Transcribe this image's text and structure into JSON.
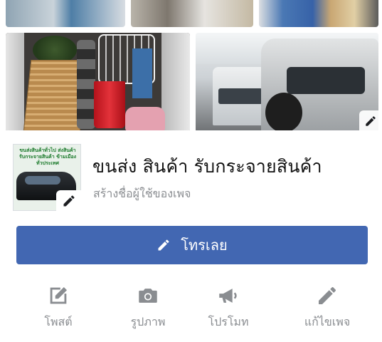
{
  "cover": {
    "profile_thumbnail_text": "ขนส่งสินค้าทั่วไป ส่งสินค้า รับกระจายสินค้า ข้ามเมือง ทั่วประเทศ"
  },
  "page": {
    "name": "ขนส่ง สินค้า รับกระจายสินค้า",
    "create_username_link": "สร้างชื่อผู้ใช้ของเพจ"
  },
  "primary_button": {
    "label": "โทรเลย",
    "icon": "pencil-icon",
    "color": "#4267b2"
  },
  "actions": [
    {
      "label": "โพสต์",
      "icon": "compose-icon"
    },
    {
      "label": "รูปภาพ",
      "icon": "camera-icon"
    },
    {
      "label": "โปรโมท",
      "icon": "megaphone-icon"
    },
    {
      "label": "แก้ไขเพจ",
      "icon": "pencil-icon"
    }
  ],
  "colors": {
    "icon_gray": "#8a8d91",
    "title_text": "#111111"
  }
}
